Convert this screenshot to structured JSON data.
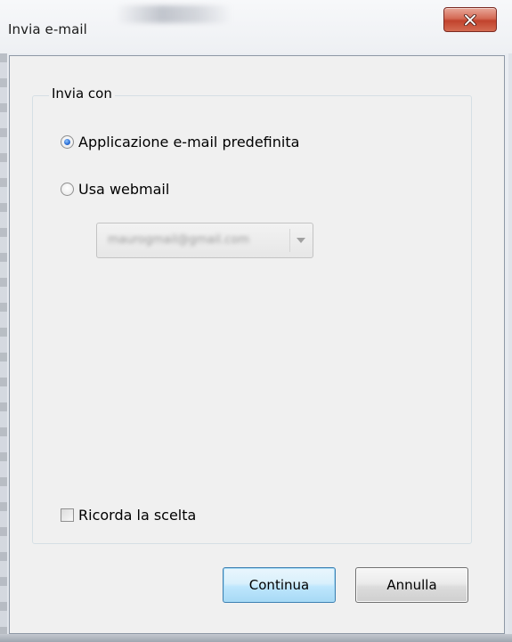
{
  "window": {
    "title": "Invia e-mail",
    "close_icon": "close-icon"
  },
  "group": {
    "label": "Invia con"
  },
  "options": [
    {
      "label": "Applicazione e-mail predefinita",
      "selected": true
    },
    {
      "label": "Usa webmail",
      "selected": false
    }
  ],
  "webmail_select": {
    "value": "maurogmail@gmail.com",
    "enabled": false,
    "arrow_icon": "dropdown-arrow-icon"
  },
  "remember": {
    "label": "Ricorda la scelta",
    "checked": false
  },
  "buttons": {
    "continue_label": "Continua",
    "cancel_label": "Annulla"
  },
  "colors": {
    "close_button": "#c9523c",
    "default_button_border": "#3c7fb1",
    "radio_selected": "#2a6cd4"
  }
}
